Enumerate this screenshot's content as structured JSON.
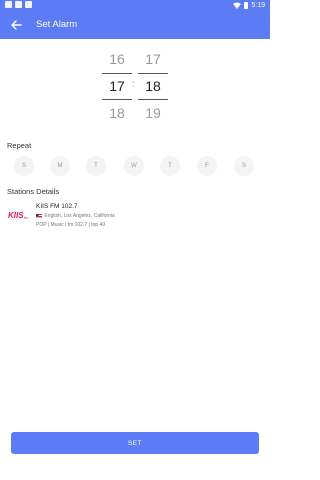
{
  "status_bar": {
    "time": "5:19",
    "icons": [
      "notification-icon",
      "notification-icon",
      "notification-icon",
      "wifi-icon",
      "battery-icon"
    ]
  },
  "app_bar": {
    "title": "Set Alarm",
    "back_icon": "arrow-left-icon"
  },
  "time_picker": {
    "hours": {
      "prev": "16",
      "current": "17",
      "next": "18"
    },
    "minutes": {
      "prev": "17",
      "current": "18",
      "next": "19"
    },
    "separator": ":"
  },
  "repeat": {
    "label": "Repeat",
    "days": [
      "S",
      "M",
      "T",
      "W",
      "T",
      "F",
      "S"
    ]
  },
  "stations": {
    "label": "Stations Details",
    "station": {
      "name": "KIIS FM 102.7",
      "logo_text": "KIIS",
      "flag_icon": "us-flag-icon",
      "location": "English, Los Angeles, California",
      "tags": "POP | Music | fm 102.7 | top 40"
    }
  },
  "set_button": {
    "label": "SET"
  },
  "colors": {
    "accent": "#5b7cf5",
    "logo": "#d81b60"
  }
}
